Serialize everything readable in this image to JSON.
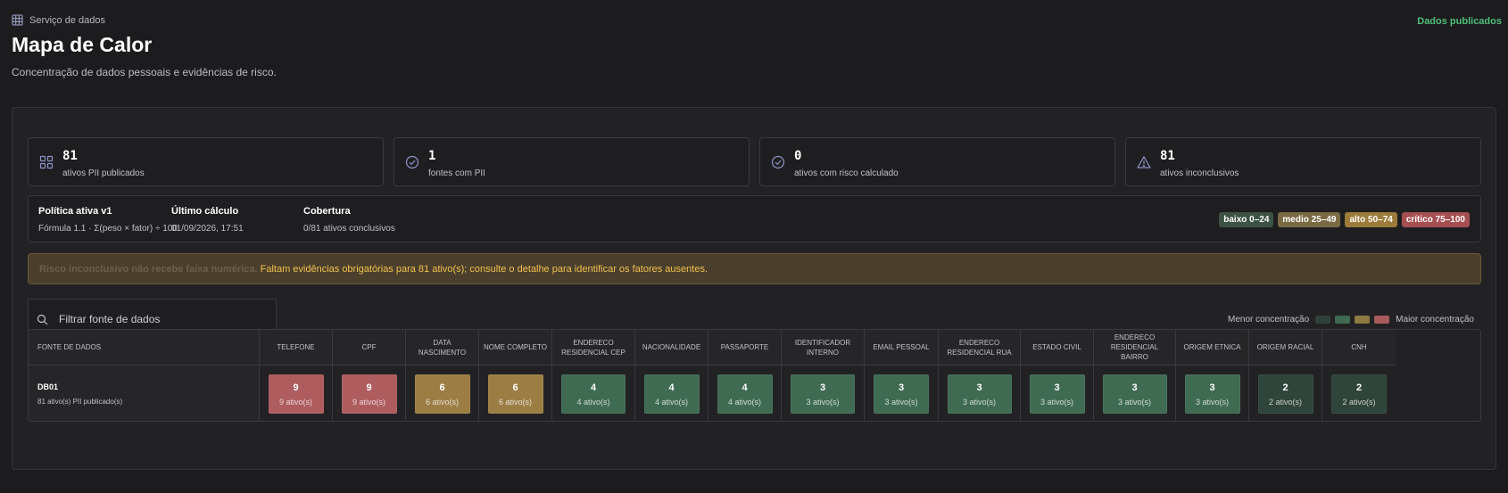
{
  "breadcrumb": {
    "label": "Serviço de dados",
    "icon": "grid-icon"
  },
  "status": "Dados publicados",
  "page": {
    "title": "Mapa de Calor",
    "subtitle": "Concentração de dados pessoais e evidências de risco."
  },
  "stats": [
    {
      "value": "81",
      "label": "ativos PII publicados",
      "icon": "grid-icon"
    },
    {
      "value": "1",
      "label": "fontes com PII",
      "icon": "check-circle-icon"
    },
    {
      "value": "0",
      "label": "ativos com risco calculado",
      "icon": "check-circle-icon"
    },
    {
      "value": "81",
      "label": "ativos inconclusivos",
      "icon": "warning-icon"
    }
  ],
  "policy": {
    "name_title": "Política ativa v1",
    "formula": "Fórmula 1.1 · Σ(peso × fator) ÷ 100",
    "calc_title": "Último cálculo",
    "calc_value": "01/09/2026, 17:51",
    "coverage_title": "Cobertura",
    "coverage_value": "0/81 ativos conclusivos"
  },
  "risk_bands": [
    {
      "label": "baixo 0–24",
      "color": "#3c5245"
    },
    {
      "label": "medio 25–49",
      "color": "#7a6a44"
    },
    {
      "label": "alto 50–74",
      "color": "#9c7c3a"
    },
    {
      "label": "crítico 75–100",
      "color": "#a64f52"
    }
  ],
  "alert": {
    "muted": "Risco inconclusivo não recebe faixa numérica.",
    "text": "Faltam evidências obrigatórias para 81 ativo(s); consulte o detalhe para identificar os fatores ausentes."
  },
  "filter": {
    "placeholder": "Filtrar fonte de dados"
  },
  "scale_legend": {
    "low": "Menor concentração",
    "high": "Maior concentração",
    "colors": [
      "#2f4038",
      "#3e6a52",
      "#8e7a42",
      "#a85a5c"
    ]
  },
  "table": {
    "source_header": "FONTE DE DADOS",
    "source_name": "DB01",
    "source_sub": "81 ativo(s) PII publicado(s)",
    "columns": [
      {
        "header": "TELEFONE",
        "value": "9",
        "sub": "9 ativo(s)",
        "color": "#ae5c5e"
      },
      {
        "header": "CPF",
        "value": "9",
        "sub": "9 ativo(s)",
        "color": "#ae5c5e"
      },
      {
        "header": "DATA NASCIMENTO",
        "value": "6",
        "sub": "6 ativo(s)",
        "color": "#9c7e45"
      },
      {
        "header": "NOME COMPLETO",
        "value": "6",
        "sub": "6 ativo(s)",
        "color": "#9c7e45"
      },
      {
        "header": "ENDERECO RESIDENCIAL CEP",
        "value": "4",
        "sub": "4 ativo(s)",
        "color": "#3f6b53"
      },
      {
        "header": "NACIONALIDADE",
        "value": "4",
        "sub": "4 ativo(s)",
        "color": "#3f6b53"
      },
      {
        "header": "PASSAPORTE",
        "value": "4",
        "sub": "4 ativo(s)",
        "color": "#3f6b53"
      },
      {
        "header": "IDENTIFICADOR INTERNO",
        "value": "3",
        "sub": "3 ativo(s)",
        "color": "#3f6b53"
      },
      {
        "header": "EMAIL PESSOAL",
        "value": "3",
        "sub": "3 ativo(s)",
        "color": "#3f6b53"
      },
      {
        "header": "ENDERECO RESIDENCIAL RUA",
        "value": "3",
        "sub": "3 ativo(s)",
        "color": "#3f6b53"
      },
      {
        "header": "ESTADO CIVIL",
        "value": "3",
        "sub": "3 ativo(s)",
        "color": "#3f6b53"
      },
      {
        "header": "ENDERECO RESIDENCIAL BAIRRO",
        "value": "3",
        "sub": "3 ativo(s)",
        "color": "#3f6b53"
      },
      {
        "header": "ORIGEM ETNICA",
        "value": "3",
        "sub": "3 ativo(s)",
        "color": "#3f6b53"
      },
      {
        "header": "ORIGEM RACIAL",
        "value": "2",
        "sub": "2 ativo(s)",
        "color": "#2f443a"
      },
      {
        "header": "CNH",
        "value": "2",
        "sub": "2 ativo(s)",
        "color": "#2f443a"
      }
    ]
  }
}
